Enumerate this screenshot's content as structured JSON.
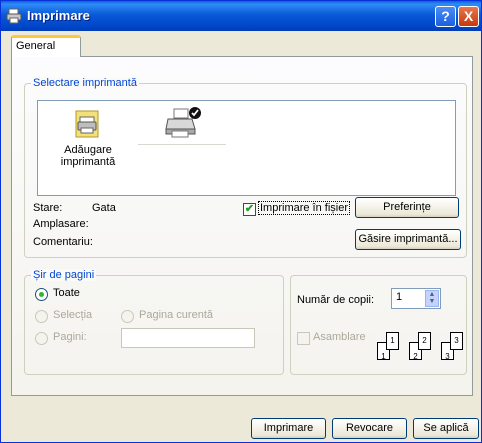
{
  "window": {
    "title": "Imprimare",
    "help_label": "?",
    "close_label": "X"
  },
  "tabs": [
    {
      "label": "General"
    }
  ],
  "select_printer": {
    "legend": "Selectare imprimantă",
    "items": [
      {
        "label_line1": "Adăugare",
        "label_line2": "imprimantă"
      },
      {
        "label_line1": ""
      }
    ],
    "status_label": "Stare:",
    "status_value": "Gata",
    "location_label": "Amplasare:",
    "comment_label": "Comentariu:",
    "print_to_file_label": "Imprimare în fișier",
    "print_to_file_checked": true,
    "preferences_label": "Preferințe",
    "find_printer_label": "Găsire imprimantă..."
  },
  "page_range": {
    "legend": "Șir de pagini",
    "all_label": "Toate",
    "selection_label": "Selecția",
    "current_page_label": "Pagina curentă",
    "pages_label": "Pagini:",
    "pages_value": ""
  },
  "copies": {
    "count_label": "Număr de copii:",
    "count_value": "1",
    "collate_label": "Asamblare",
    "collate_pages": [
      "1",
      "1",
      "2",
      "2",
      "3",
      "3"
    ]
  },
  "buttons": {
    "print": "Imprimare",
    "cancel": "Revocare",
    "apply": "Se aplică"
  },
  "colors": {
    "title_bar": "#0054e3",
    "legend": "#0046d5",
    "checked": "#21a121"
  }
}
